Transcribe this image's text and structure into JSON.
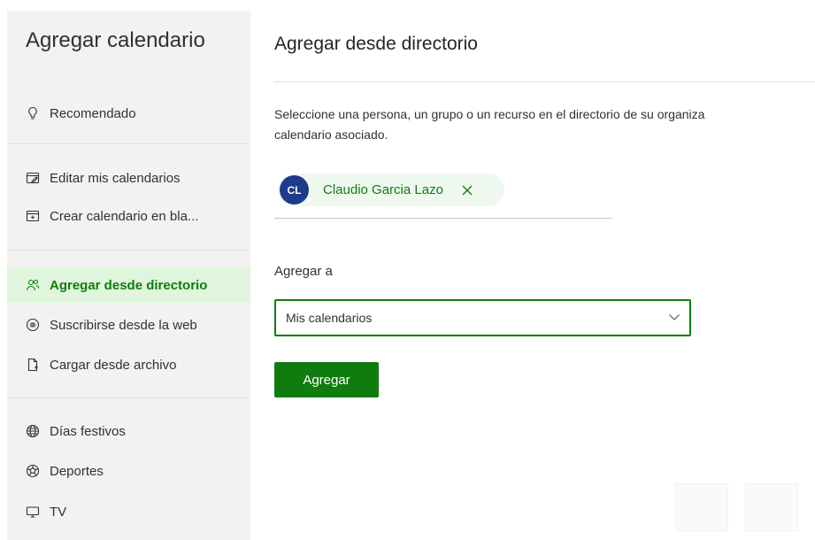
{
  "sidebar": {
    "title": "Agregar calendario",
    "items": [
      {
        "label": "Recomendado",
        "icon": "lightbulb-icon"
      },
      {
        "label": "Editar mis calendarios",
        "icon": "edit-calendar-icon"
      },
      {
        "label": "Crear calendario en bla...",
        "icon": "new-calendar-icon"
      },
      {
        "label": "Agregar desde directorio",
        "icon": "people-directory-icon",
        "active": true
      },
      {
        "label": "Suscribirse desde la web",
        "icon": "web-link-icon"
      },
      {
        "label": "Cargar desde archivo",
        "icon": "file-upload-icon"
      },
      {
        "label": "Días festivos",
        "icon": "globe-icon"
      },
      {
        "label": "Deportes",
        "icon": "sports-ball-icon"
      },
      {
        "label": "TV",
        "icon": "tv-icon"
      }
    ]
  },
  "main": {
    "title": "Agregar desde directorio",
    "description_line1": "Seleccione una persona, un grupo o un recurso en el directorio de su organiza",
    "description_line2": "calendario asociado.",
    "selected_person": {
      "initials": "CL",
      "name": "Claudio Garcia Lazo",
      "remove_icon": "close-icon"
    },
    "add_to_label": "Agregar a",
    "calendar_select": {
      "value": "Mis calendarios",
      "icon": "chevron-down-icon"
    },
    "add_button_label": "Agregar"
  },
  "colors": {
    "accent": "#107c10",
    "active_bg": "#dff6dd",
    "avatar": "#1e3a8a",
    "sidebar_bg": "#f3f2f1"
  }
}
